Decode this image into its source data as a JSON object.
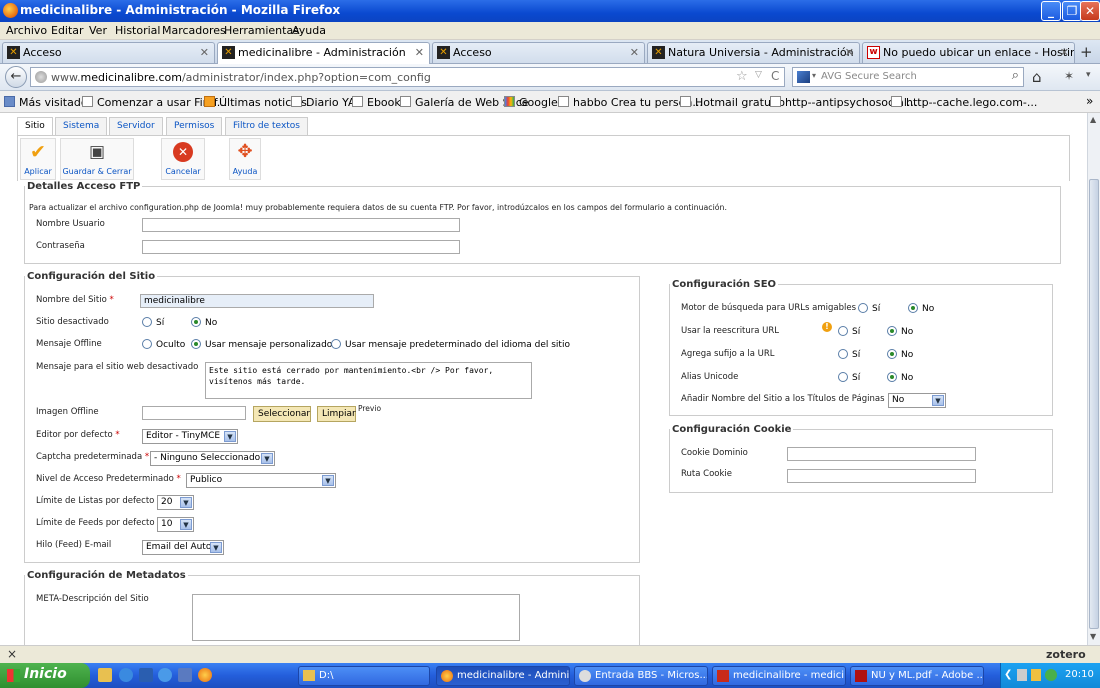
{
  "window": {
    "title": "medicinalibre - Administración - Mozilla Firefox"
  },
  "menu": [
    "Archivo",
    "Editar",
    "Ver",
    "Historial",
    "Marcadores",
    "Herramientas",
    "Ayuda"
  ],
  "tabs": [
    {
      "label": "Acceso"
    },
    {
      "label": "medicinalibre - Administración",
      "active": true
    },
    {
      "label": "Acceso"
    },
    {
      "label": "Natura Universia - Administración"
    },
    {
      "label": "No puedo ubicar un enlace - Hosting Joo..."
    }
  ],
  "nav": {
    "url_prefix": "www.",
    "url_domain": "medicinalibre.com",
    "url_path": "/administrator/index.php?option=com_config",
    "search_placeholder": "AVG Secure Search"
  },
  "bookmarks": [
    "Más visitados",
    "Comenzar a usar Firef...",
    "Últimas noticias",
    "Diario YA",
    "Ebook",
    "Galería de Web Slice",
    "Google",
    "habbo Crea tu person...",
    "Hotmail gratuito",
    "http--antipsychosocial...",
    "http--cache.lego.com-..."
  ],
  "subtabs": [
    "Sitio",
    "Sistema",
    "Servidor",
    "Permisos",
    "Filtro de textos"
  ],
  "toolbar": {
    "apply": "Aplicar",
    "save_close": "Guardar & Cerrar",
    "cancel": "Cancelar",
    "help": "Ayuda"
  },
  "ftp": {
    "legend": "Detalles Acceso FTP",
    "desc": "Para actualizar el archivo configuration.php de Joomla! muy probablemente requiera datos de su cuenta FTP. Por favor, introdúzcalos en los campos del formulario a continuación.",
    "user_label": "Nombre Usuario",
    "password_label": "Contraseña"
  },
  "site": {
    "legend": "Configuración del Sitio",
    "site_name_label": "Nombre del Sitio",
    "site_name_value": "medicinalibre",
    "offline_label": "Sitio desactivado",
    "yes": "Sí",
    "no": "No",
    "offline_msg_label": "Mensaje Offline",
    "offline_msg_opt1": "Oculto",
    "offline_msg_opt2": "Usar mensaje personalizado",
    "offline_msg_opt3": "Usar mensaje predeterminado del idioma del sitio",
    "offline_text_label": "Mensaje para el sitio web desactivado",
    "offline_text_value": "Este sitio está cerrado por mantenimiento.<br /> Por favor, visítenos más tarde.",
    "offline_image_label": "Imagen Offline",
    "select_btn": "Seleccionar",
    "clear_btn": "Limpiar",
    "preview": "Previo",
    "editor_label": "Editor por defecto",
    "editor_value": "Editor - TinyMCE",
    "captcha_label": "Captcha predeterminada",
    "captcha_value": "- Ninguno Seleccionado -",
    "access_label": "Nivel de Acceso Predeterminado",
    "access_value": "Publico",
    "list_limit_label": "Límite de Listas por defecto",
    "list_limit_value": "20",
    "feed_limit_label": "Límite de Feeds por defecto",
    "feed_limit_value": "10",
    "feed_email_label": "Hilo (Feed) E-mail",
    "feed_email_value": "Email del Autor"
  },
  "meta": {
    "legend": "Configuración de Metadatos",
    "desc_label": "META-Descripción del Sitio"
  },
  "seo": {
    "legend": "Configuración SEO",
    "sef_label": "Motor de búsqueda para URLs amigables",
    "rewrite_label": "Usar la reescritura URL",
    "suffix_label": "Agrega sufijo a la URL",
    "unicode_label": "Alias Unicode",
    "sitename_label": "Añadir Nombre del Sitio a los Títulos de Páginas",
    "sitename_value": "No",
    "yes": "Sí",
    "no": "No"
  },
  "cookie": {
    "legend": "Configuración Cookie",
    "domain_label": "Cookie Dominio",
    "path_label": "Ruta Cookie"
  },
  "addonbar": {
    "close": "×",
    "zotero": "zotero"
  },
  "taskbar": {
    "start": "Inicio",
    "tasks": [
      "D:\\",
      "medicinalibre - Admini...",
      "Entrada BBS - Micros...",
      "medicinalibre - medici...",
      "NU y ML.pdf - Adobe ..."
    ],
    "clock": "20:10"
  },
  "colors": {
    "titlebar": "#0a49d0",
    "link": "#0b55c4",
    "taskbar": "#245edb",
    "start": "#2f8f2f"
  }
}
